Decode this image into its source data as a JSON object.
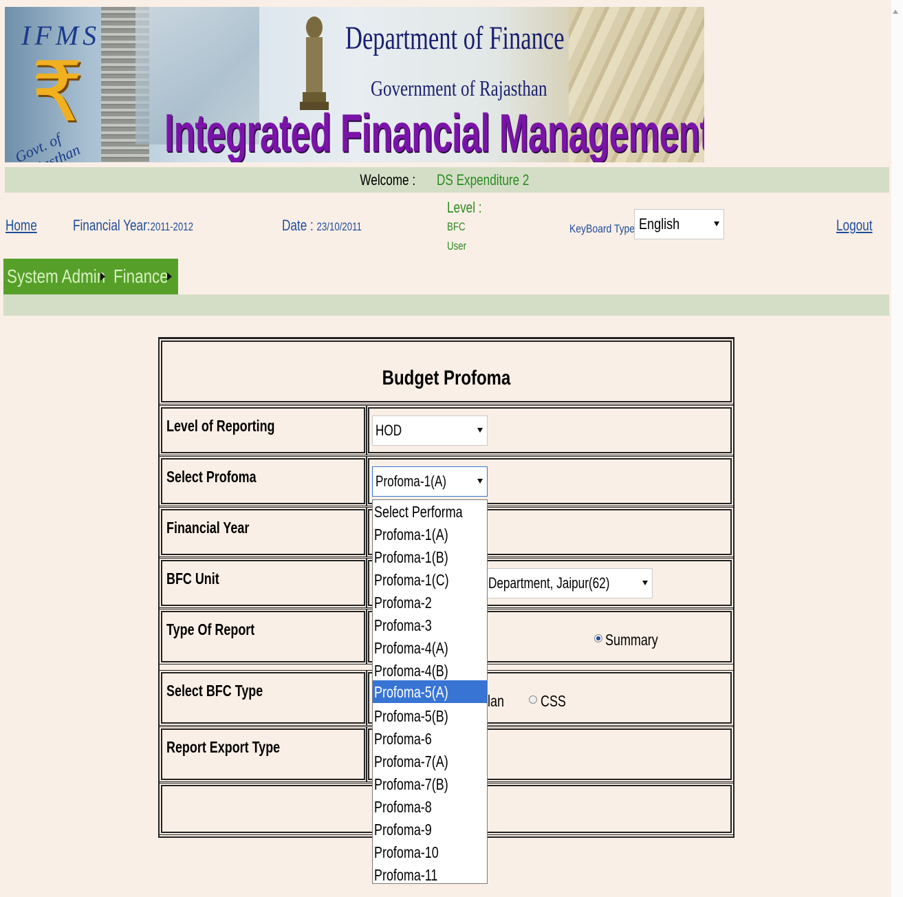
{
  "header": {
    "logo_letters": "IFMS",
    "logo_symbol": "₹",
    "logo_caption": "Govt. of Rajasthan",
    "dept_title": "Department of Finance",
    "govt_title": "Government of Rajasthan",
    "system_title": "Integrated Financial Management System"
  },
  "welcome": {
    "label": "Welcome : ",
    "user": "DS Expenditure 2"
  },
  "info": {
    "home": "Home",
    "fy_label": "Financial Year:",
    "fy_value": "2011-2012",
    "date_label": "Date : ",
    "date_value": "23/10/2011",
    "level_label": "Level :",
    "level_line1": "BFC",
    "level_line2": "User",
    "keyboard_label": "KeyBoard Type:",
    "keyboard_value": "English",
    "logout": "Logout"
  },
  "menu": {
    "items": [
      "System Admin",
      "Finance"
    ]
  },
  "form": {
    "title": "Budget Profoma",
    "rows": [
      {
        "label": "Level of Reporting"
      },
      {
        "label": "Select Profoma"
      },
      {
        "label": "Financial Year"
      },
      {
        "label": "BFC Unit"
      },
      {
        "label": "Type Of Report"
      },
      {
        "label": "Select BFC Type"
      },
      {
        "label": "Report Export Type"
      }
    ],
    "level_value": "HOD",
    "profoma_value": "Profoma-1(A)",
    "bfc_unit_value": "Department, Jaipur(62)",
    "report_type_option": "Summary",
    "bfc_type_partial": "lan",
    "bfc_type_css": "CSS"
  },
  "dropdown": {
    "options": [
      "Select Performa",
      "Profoma-1(A)",
      "Profoma-1(B)",
      "Profoma-1(C)",
      "Profoma-2",
      "Profoma-3",
      "Profoma-4(A)",
      "Profoma-4(B)",
      "Profoma-5(A)",
      "Profoma-5(B)",
      "Profoma-6",
      "Profoma-7(A)",
      "Profoma-7(B)",
      "Profoma-8",
      "Profoma-9",
      "Profoma-10",
      "Profoma-11"
    ],
    "highlighted": "Profoma-5(A)"
  },
  "colors": {
    "page_bg": "#faefe6",
    "bar_green": "#d4dec6",
    "menu_green": "#56a02a",
    "link_blue": "#1f4d9a",
    "user_green": "#2a8a20",
    "title_purple": "#7a14a8",
    "highlight_blue": "#3874d4"
  }
}
